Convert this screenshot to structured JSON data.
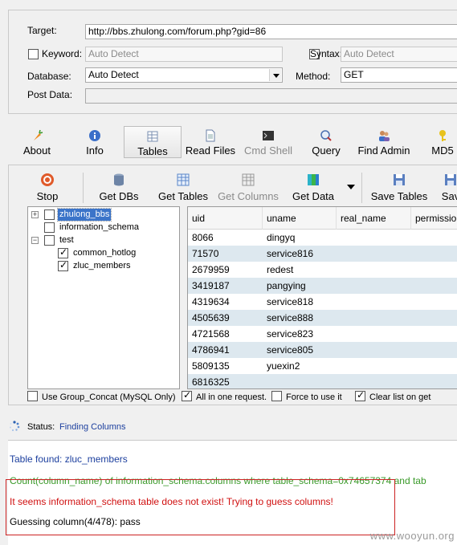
{
  "request": {
    "target_label": "Target:",
    "target_value": "http://bbs.zhulong.com/forum.php?gid=86",
    "keyword_label": "Keyword:",
    "keyword_placeholder": "Auto Detect",
    "syntax_label": "Syntax:",
    "syntax_placeholder": "Auto Detect",
    "database_label": "Database:",
    "database_value": "Auto Detect",
    "method_label": "Method:",
    "method_value": "GET",
    "postdata_label": "Post Data:"
  },
  "toolbar": {
    "items": [
      {
        "label": "About",
        "icon": "carrot-icon"
      },
      {
        "label": "Info",
        "icon": "info-icon"
      },
      {
        "label": "Tables",
        "icon": "table-icon"
      },
      {
        "label": "Read Files",
        "icon": "file-icon"
      },
      {
        "label": "Cmd Shell",
        "icon": "console-icon"
      },
      {
        "label": "Query",
        "icon": "query-icon"
      },
      {
        "label": "Find Admin",
        "icon": "users-icon"
      },
      {
        "label": "MD5",
        "icon": "key-icon"
      }
    ]
  },
  "subtoolbar": {
    "items": [
      {
        "label": "Stop",
        "icon": "stop-icon"
      },
      {
        "label": "Get DBs",
        "icon": "database-icon"
      },
      {
        "label": "Get Tables",
        "icon": "tables-icon"
      },
      {
        "label": "Get Columns",
        "icon": "columns-icon"
      },
      {
        "label": "Get Data",
        "icon": "data-icon"
      },
      {
        "label": "Save Tables",
        "icon": "save-icon"
      },
      {
        "label": "Sav",
        "icon": "save-icon"
      }
    ]
  },
  "tree": {
    "nodes": [
      {
        "label": "zhulong_bbs",
        "expander": "+",
        "checked": false,
        "selected": true
      },
      {
        "label": "information_schema",
        "expander": "",
        "checked": false,
        "selected": false
      },
      {
        "label": "test",
        "expander": "−",
        "checked": false,
        "selected": false
      },
      {
        "label": "common_hotlog",
        "expander": "",
        "checked": true,
        "selected": false
      },
      {
        "label": "zluc_members",
        "expander": "",
        "checked": true,
        "selected": false
      }
    ]
  },
  "grid": {
    "columns": [
      "uid",
      "uname",
      "real_name",
      "permission"
    ],
    "rows": [
      [
        "8066",
        "dingyq"
      ],
      [
        "71570",
        "service816"
      ],
      [
        "2679959",
        "redest"
      ],
      [
        "3419187",
        "pangying"
      ],
      [
        "4319634",
        "service818"
      ],
      [
        "4505639",
        "service888"
      ],
      [
        "4721568",
        "service823"
      ],
      [
        "4786941",
        "service805"
      ],
      [
        "5809135",
        "yuexin2"
      ],
      [
        "6816325",
        ""
      ]
    ]
  },
  "options": {
    "group_concat": "Use Group_Concat (MySQL Only)",
    "all_in_one": "All in one request.",
    "force_use": "Force to use it",
    "clear_list": "Clear list on get"
  },
  "status": {
    "label": "Status:",
    "value": "Finding Columns"
  },
  "log": {
    "lines": [
      "Table found: zluc_members",
      "Count(column_name) of information_schema.columns where table_schema=0x74657374 and tab",
      "It seems information_schema table does not exist! Trying to guess columns!",
      "Guessing column(4/478): pass"
    ]
  },
  "watermark": "www.wooyun.org",
  "colors": {
    "log_blue": "#1c3f9e",
    "log_green": "#3a9a2a",
    "log_red": "#d01010",
    "highlight_box": "#cc2222"
  }
}
